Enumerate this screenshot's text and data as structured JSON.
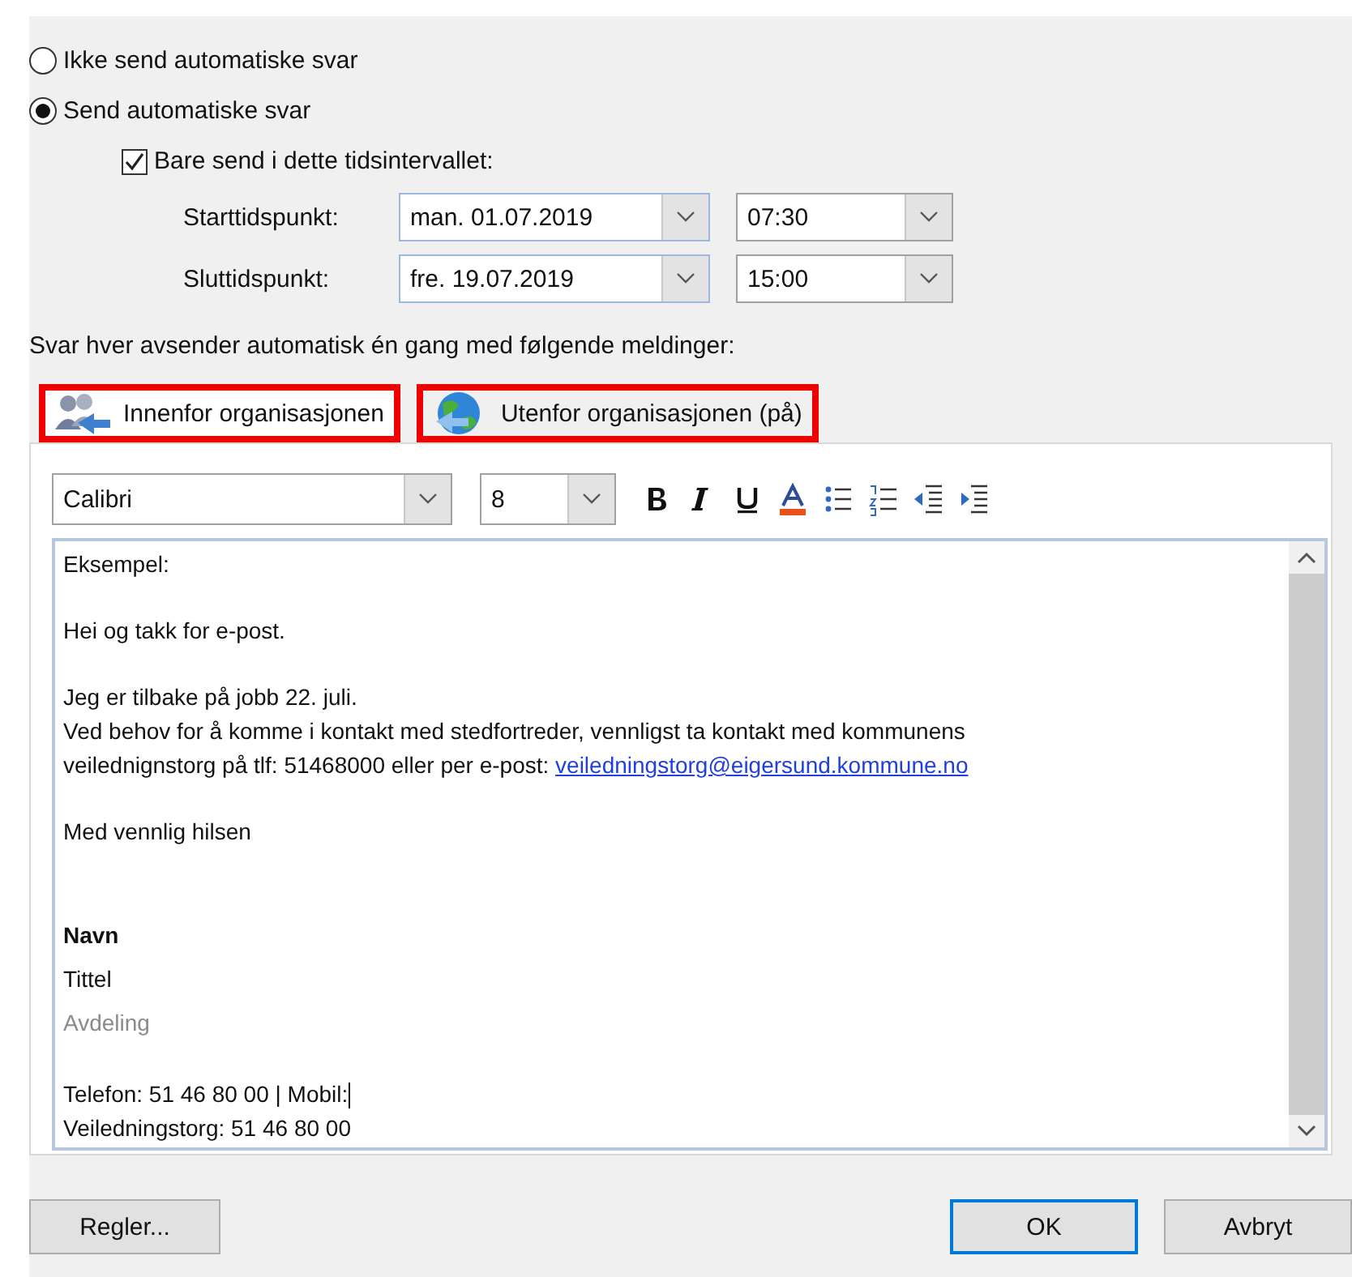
{
  "options": [
    {
      "label": "Ikke send automatiske svar",
      "selected": false
    },
    {
      "label": "Send automatiske svar",
      "selected": true
    }
  ],
  "time_range": {
    "label": "Bare send i dette tidsintervallet:",
    "checked": true,
    "rows": [
      {
        "label": "Starttidspunkt:",
        "date": "man. 01.07.2019",
        "time": "07:30"
      },
      {
        "label": "Sluttidspunkt:",
        "date": "fre. 19.07.2019",
        "time": "15:00"
      }
    ]
  },
  "instruction": "Svar hver avsender automatisk én gang med følgende meldinger:",
  "tabs": [
    {
      "label": "Innenfor organisasjonen",
      "selected": true,
      "highlighted": true,
      "kind": "people"
    },
    {
      "label": "Utenfor organisasjonen (på)",
      "selected": false,
      "highlighted": true,
      "kind": "globe"
    }
  ],
  "toolbar": {
    "font": "Calibri",
    "size": "8"
  },
  "message": [
    {
      "kind": "text",
      "text": "Eksempel:"
    },
    {
      "kind": "gap"
    },
    {
      "kind": "text",
      "text": "Hei og takk for e-post."
    },
    {
      "kind": "gap"
    },
    {
      "kind": "text",
      "text": "Jeg er tilbake på jobb 22. juli."
    },
    {
      "kind": "text",
      "text": "Ved behov for å komme i kontakt med stedfortreder, vennligst ta kontakt med kommunens"
    },
    {
      "kind": "link",
      "text": "veilednignstorg på tlf: 51468000 eller per e-post: ",
      "link": "veiledningstorg@eigersund.kommune.no"
    },
    {
      "kind": "gap"
    },
    {
      "kind": "text",
      "text": "Med vennlig hilsen"
    },
    {
      "kind": "gap"
    },
    {
      "kind": "gap"
    },
    {
      "kind": "bold",
      "text": "Navn"
    },
    {
      "kind": "field",
      "text": "Tittel"
    },
    {
      "kind": "muted",
      "text": "Avdeling"
    },
    {
      "kind": "gap"
    },
    {
      "kind": "caret",
      "text": "Telefon: 51 46 80 00 |  Mobil:"
    },
    {
      "kind": "text",
      "text": "Veiledningstorg: 51 46 80 00"
    }
  ],
  "buttons": [
    {
      "label": "Regler...",
      "kind": "left",
      "focused": false
    },
    {
      "label": "OK",
      "kind": "right",
      "focused": true
    },
    {
      "label": "Avbryt",
      "kind": "right",
      "focused": false
    }
  ]
}
